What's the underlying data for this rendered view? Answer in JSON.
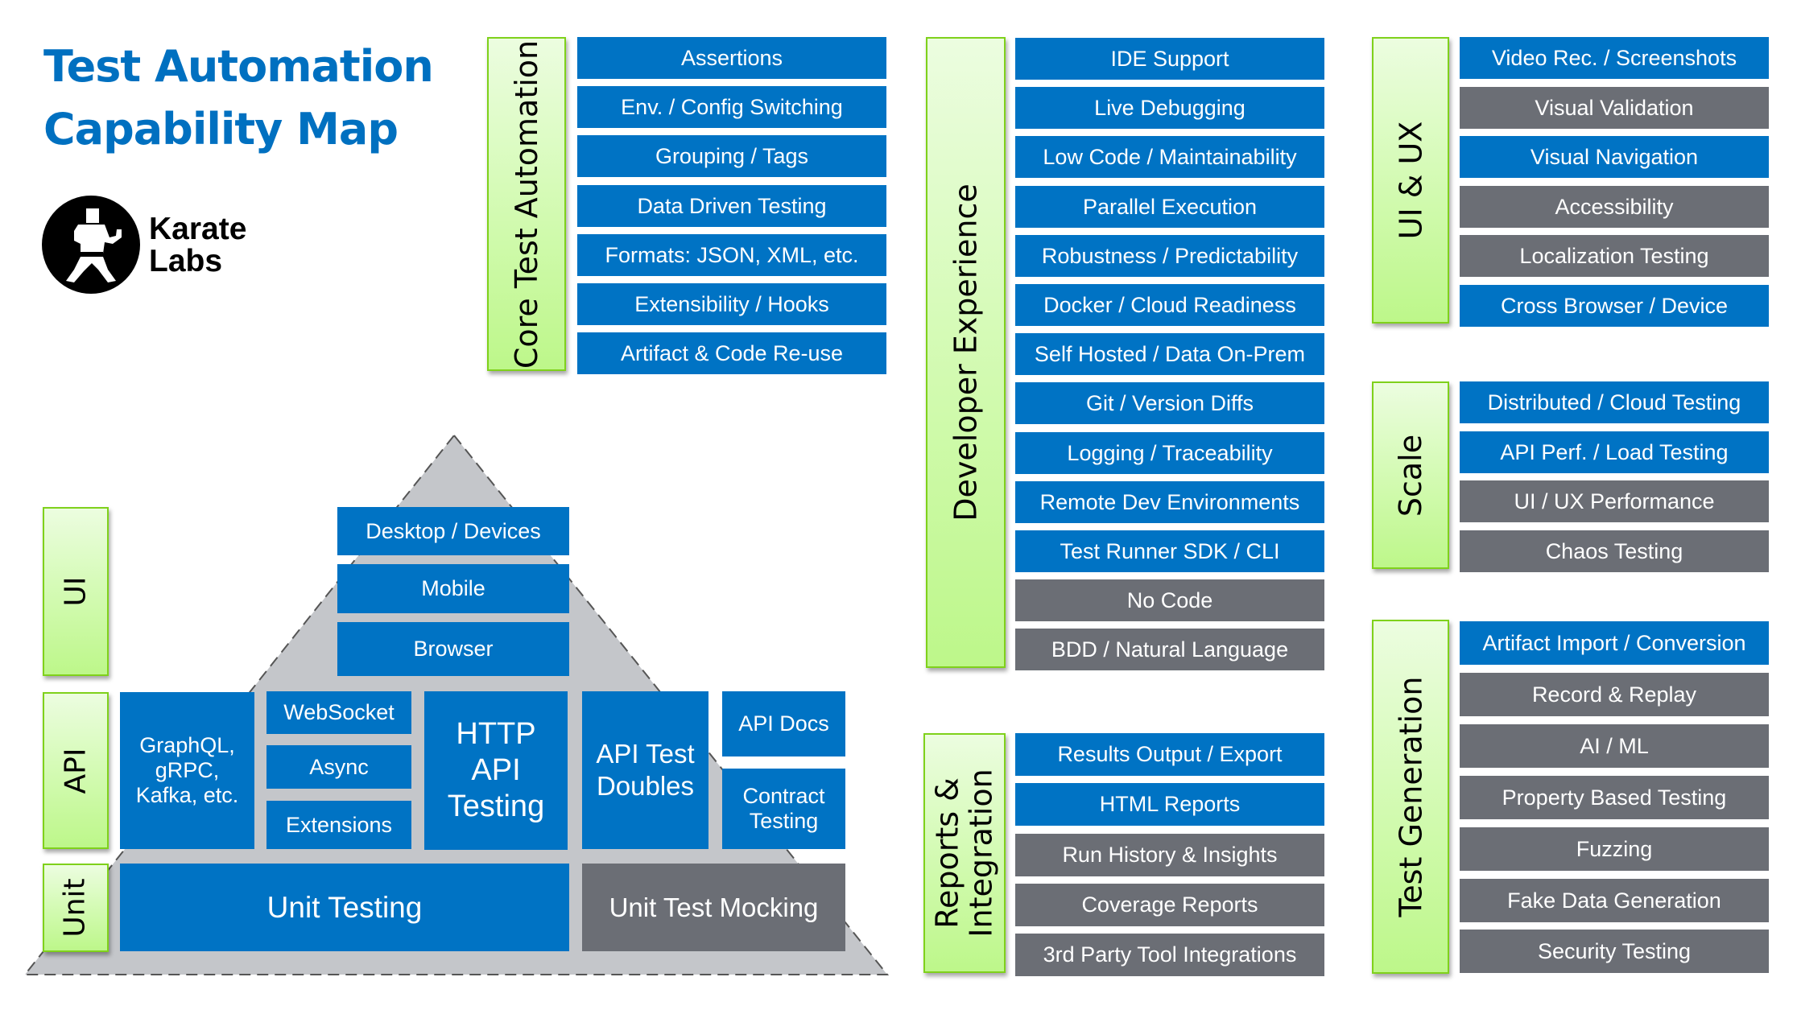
{
  "header": {
    "title_line1": "Test Automation",
    "title_line2": "Capability Map",
    "logo": {
      "icon": "karate-figure-icon",
      "line1": "Karate",
      "line2": "Labs"
    }
  },
  "colors": {
    "title": "#0070c0",
    "available": "#0073c4",
    "not_available": "#6b6e75",
    "category_border": "#7fd11b",
    "pyramid_fill": "#c4c6ca"
  },
  "pyramid": {
    "layers": [
      {
        "label": "UI"
      },
      {
        "label": "API"
      },
      {
        "label": "Unit"
      }
    ],
    "ui_boxes": [
      {
        "label": "Desktop / Devices",
        "status": "available"
      },
      {
        "label": "Mobile",
        "status": "available"
      },
      {
        "label": "Browser",
        "status": "available"
      }
    ],
    "api_boxes": {
      "graphql": {
        "label_lines": [
          "GraphQL,",
          "gRPC,",
          "Kafka, etc."
        ],
        "status": "available"
      },
      "websocket": {
        "label": "WebSocket",
        "status": "available"
      },
      "async": {
        "label": "Async",
        "status": "available"
      },
      "extensions": {
        "label": "Extensions",
        "status": "available"
      },
      "http": {
        "label_lines": [
          "HTTP",
          "API",
          "Testing"
        ],
        "status": "available"
      },
      "doubles": {
        "label_lines": [
          "API Test",
          "Doubles"
        ],
        "status": "available"
      },
      "docs": {
        "label": "API Docs",
        "status": "available"
      },
      "contract": {
        "label_lines": [
          "Contract",
          "Testing"
        ],
        "status": "available"
      }
    },
    "unit_boxes": [
      {
        "label": "Unit Testing",
        "status": "available"
      },
      {
        "label": "Unit Test Mocking",
        "status": "not_available"
      }
    ]
  },
  "categories": {
    "core": {
      "label": "Core Test Automation",
      "items": [
        {
          "label": "Assertions",
          "status": "available"
        },
        {
          "label": "Env. / Config Switching",
          "status": "available"
        },
        {
          "label": "Grouping / Tags",
          "status": "available"
        },
        {
          "label": "Data Driven Testing",
          "status": "available"
        },
        {
          "label": "Formats: JSON, XML, etc.",
          "status": "available"
        },
        {
          "label": "Extensibility / Hooks",
          "status": "available"
        },
        {
          "label": "Artifact & Code Re-use",
          "status": "available"
        }
      ]
    },
    "devx": {
      "label": "Developer Experience",
      "items": [
        {
          "label": "IDE Support",
          "status": "available"
        },
        {
          "label": "Live Debugging",
          "status": "available"
        },
        {
          "label": "Low Code / Maintainability",
          "status": "available"
        },
        {
          "label": "Parallel Execution",
          "status": "available"
        },
        {
          "label": "Robustness / Predictability",
          "status": "available"
        },
        {
          "label": "Docker / Cloud Readiness",
          "status": "available"
        },
        {
          "label": "Self Hosted / Data On-Prem",
          "status": "available"
        },
        {
          "label": "Git / Version Diffs",
          "status": "available"
        },
        {
          "label": "Logging / Traceability",
          "status": "available"
        },
        {
          "label": "Remote Dev Environments",
          "status": "available"
        },
        {
          "label": "Test Runner SDK / CLI",
          "status": "available"
        },
        {
          "label": "No Code",
          "status": "not_available"
        },
        {
          "label": "BDD / Natural Language",
          "status": "not_available"
        }
      ]
    },
    "reports": {
      "label_lines": [
        "Reports &",
        "Integration"
      ],
      "items": [
        {
          "label": "Results Output / Export",
          "status": "available"
        },
        {
          "label": "HTML Reports",
          "status": "available"
        },
        {
          "label": "Run History & Insights",
          "status": "not_available"
        },
        {
          "label": "Coverage Reports",
          "status": "not_available"
        },
        {
          "label": "3rd Party Tool Integrations",
          "status": "not_available"
        }
      ]
    },
    "uiux": {
      "label": "UI & UX",
      "items": [
        {
          "label": "Video Rec. / Screenshots",
          "status": "available"
        },
        {
          "label": "Visual Validation",
          "status": "not_available"
        },
        {
          "label": "Visual Navigation",
          "status": "available"
        },
        {
          "label": "Accessibility",
          "status": "not_available"
        },
        {
          "label": "Localization Testing",
          "status": "not_available"
        },
        {
          "label": "Cross Browser / Device",
          "status": "available"
        }
      ]
    },
    "scale": {
      "label": "Scale",
      "items": [
        {
          "label": "Distributed / Cloud Testing",
          "status": "available"
        },
        {
          "label": "API Perf. / Load Testing",
          "status": "available"
        },
        {
          "label": "UI / UX Performance",
          "status": "not_available"
        },
        {
          "label": "Chaos Testing",
          "status": "not_available"
        }
      ]
    },
    "testgen": {
      "label": "Test Generation",
      "items": [
        {
          "label": "Artifact Import / Conversion",
          "status": "available"
        },
        {
          "label": "Record & Replay",
          "status": "not_available"
        },
        {
          "label": "AI / ML",
          "status": "not_available"
        },
        {
          "label": "Property Based Testing",
          "status": "not_available"
        },
        {
          "label": "Fuzzing",
          "status": "not_available"
        },
        {
          "label": "Fake Data Generation",
          "status": "not_available"
        },
        {
          "label": "Security Testing",
          "status": "not_available"
        }
      ]
    }
  }
}
